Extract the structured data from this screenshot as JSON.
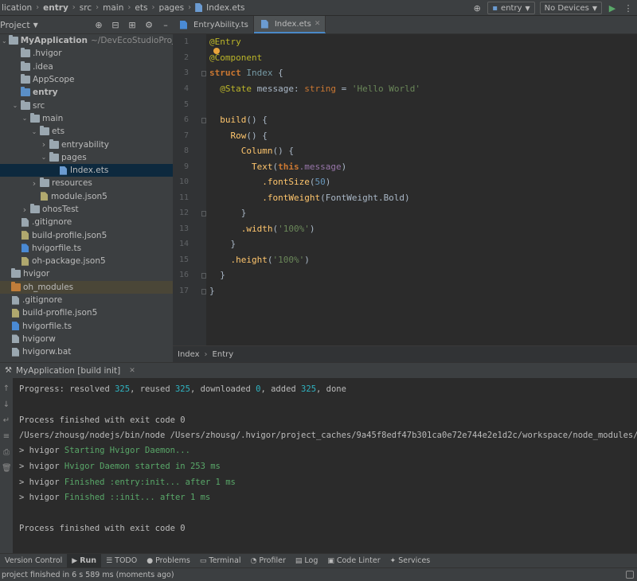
{
  "breadcrumb": {
    "items": [
      "lication",
      "entry",
      "src",
      "main",
      "ets",
      "pages",
      "Index.ets"
    ],
    "file_icon": "ets-file-icon"
  },
  "toolbar": {
    "module_combo": "entry",
    "device_combo": "No Devices",
    "icons": [
      "location-target-icon",
      "module-icon",
      "device-icon",
      "run-icon",
      "more-icon"
    ]
  },
  "project": {
    "title": "Project",
    "tools": [
      "locate-icon",
      "collapse-icon",
      "expand-icon",
      "gear-icon",
      "minimize-icon"
    ],
    "tree": [
      {
        "label": "MyApplication",
        "hint": "~/DevEcoStudioProjects/MyApplic",
        "depth": 0,
        "arrow": "down",
        "icon": "folder",
        "bold": true
      },
      {
        "label": ".hvigor",
        "depth": 1,
        "arrow": "",
        "icon": "folder"
      },
      {
        "label": ".idea",
        "depth": 1,
        "arrow": "",
        "icon": "folder"
      },
      {
        "label": "AppScope",
        "depth": 1,
        "arrow": "",
        "icon": "folder"
      },
      {
        "label": "entry",
        "depth": 1,
        "arrow": "",
        "icon": "folder-blue",
        "bold": true
      },
      {
        "label": "src",
        "depth": 1,
        "arrow": "down",
        "icon": "folder"
      },
      {
        "label": "main",
        "depth": 2,
        "arrow": "down",
        "icon": "folder"
      },
      {
        "label": "ets",
        "depth": 3,
        "arrow": "down",
        "icon": "folder"
      },
      {
        "label": "entryability",
        "depth": 4,
        "arrow": "right",
        "icon": "folder"
      },
      {
        "label": "pages",
        "depth": 4,
        "arrow": "down",
        "icon": "folder"
      },
      {
        "label": "Index.ets",
        "depth": 5,
        "arrow": "",
        "icon": "file-ets",
        "selected": true
      },
      {
        "label": "resources",
        "depth": 3,
        "arrow": "right",
        "icon": "folder"
      },
      {
        "label": "module.json5",
        "depth": 3,
        "arrow": "",
        "icon": "file-json"
      },
      {
        "label": "ohosTest",
        "depth": 2,
        "arrow": "right",
        "icon": "folder"
      },
      {
        "label": ".gitignore",
        "depth": 1,
        "arrow": "",
        "icon": "file"
      },
      {
        "label": "build-profile.json5",
        "depth": 1,
        "arrow": "",
        "icon": "file-json"
      },
      {
        "label": "hvigorfile.ts",
        "depth": 1,
        "arrow": "",
        "icon": "file-ts"
      },
      {
        "label": "oh-package.json5",
        "depth": 1,
        "arrow": "",
        "icon": "file-json"
      },
      {
        "label": "hvigor",
        "depth": 0,
        "arrow": "",
        "icon": "folder"
      },
      {
        "label": "oh_modules",
        "depth": 0,
        "arrow": "",
        "icon": "folder-orange",
        "modules": true
      },
      {
        "label": ".gitignore",
        "depth": 0,
        "arrow": "",
        "icon": "file"
      },
      {
        "label": "build-profile.json5",
        "depth": 0,
        "arrow": "",
        "icon": "file-json"
      },
      {
        "label": "hvigorfile.ts",
        "depth": 0,
        "arrow": "",
        "icon": "file-ts"
      },
      {
        "label": "hvigorw",
        "depth": 0,
        "arrow": "",
        "icon": "file"
      },
      {
        "label": "hvigorw.bat",
        "depth": 0,
        "arrow": "",
        "icon": "file"
      }
    ]
  },
  "editor": {
    "tabs": [
      {
        "label": "EntryAbility.ts",
        "active": false
      },
      {
        "label": "Index.ets",
        "active": true
      }
    ],
    "line_numbers": [
      "1",
      "2",
      "3",
      "4",
      "5",
      "6",
      "7",
      "8",
      "9",
      "10",
      "11",
      "12",
      "13",
      "14",
      "15",
      "16",
      "17"
    ],
    "code": {
      "l1": "@Entry",
      "l2": "@Component",
      "l3_kw": "struct",
      "l3_name": "Index",
      "l3_brace": "{",
      "l4_ann": "@State",
      "l4_name": "message",
      "l4_colon": ": ",
      "l4_type": "string",
      "l4_eq": " = ",
      "l4_str": "'Hello World'",
      "l6_fn": "build",
      "l6_rest": "() {",
      "l7_fn": "Row",
      "l7_rest": "() {",
      "l8_fn": "Column",
      "l8_rest": "() {",
      "l9_fn": "Text",
      "l9_open": "(",
      "l9_this": "this",
      "l9_prop": ".message",
      "l9_close": ")",
      "l10_fn": ".fontSize",
      "l10_open": "(",
      "l10_num": "50",
      "l10_close": ")",
      "l11_fn": ".fontWeight",
      "l11_arg": "(FontWeight.Bold)",
      "l12": "}",
      "l13_fn": ".width",
      "l13_open": "(",
      "l13_str": "'100%'",
      "l13_close": ")",
      "l14": "}",
      "l15_fn": ".height",
      "l15_open": "(",
      "l15_str": "'100%'",
      "l15_close": ")",
      "l16": "}",
      "l17": "}"
    },
    "crumb": [
      "Index",
      "Entry"
    ]
  },
  "run": {
    "tab_label": "MyApplication [build init]",
    "side_icons": [
      "up-arrow-icon",
      "down-arrow-icon",
      "wrap-icon",
      "sort-icon",
      "print-icon",
      "trash-icon"
    ],
    "console": {
      "progress_prefix": "Progress: resolved ",
      "resolved": "325",
      "reused_label": ", reused ",
      "reused": "325",
      "downloaded_label": ", downloaded ",
      "downloaded": "0",
      "added_label": ", added ",
      "added": "325",
      "done_label": ", done",
      "exit1": "Process finished with exit code 0",
      "cmd": "/Users/zhousg/nodejs/bin/node /Users/zhousg/.hvigor/project_caches/9a45f8edf47b301ca0e72e744e2e1d2c/workspace/node_modules/@ohos/hvigor/bin/hvigor.js",
      "h1_prefix": "> hvigor ",
      "h1_msg": "Starting Hvigor Daemon...",
      "h2_prefix": "> hvigor ",
      "h2_msg": "Hvigor Daemon started in 253 ms",
      "h3_prefix": "> hvigor ",
      "h3_msg": "Finished :entry:init... after 1 ms",
      "h4_prefix": "> hvigor ",
      "h4_msg": "Finished ::init... after 1 ms",
      "exit2": "Process finished with exit code 0"
    }
  },
  "tool_strip": [
    {
      "label": "Version Control",
      "icon": ""
    },
    {
      "label": "Run",
      "icon": "▶",
      "active": true
    },
    {
      "label": "TODO",
      "icon": "☰"
    },
    {
      "label": "Problems",
      "icon": "●"
    },
    {
      "label": "Terminal",
      "icon": "▭"
    },
    {
      "label": "Profiler",
      "icon": "◔"
    },
    {
      "label": "Log",
      "icon": "▤"
    },
    {
      "label": "Code Linter",
      "icon": "▣"
    },
    {
      "label": "Services",
      "icon": "✦"
    }
  ],
  "status": "project finished in 6 s 589 ms (moments ago)",
  "colors": {
    "accent": "#4a88c7",
    "selection": "#0d293e",
    "keyword": "#cc7832",
    "string": "#6a8759",
    "annotation": "#bbb529"
  }
}
